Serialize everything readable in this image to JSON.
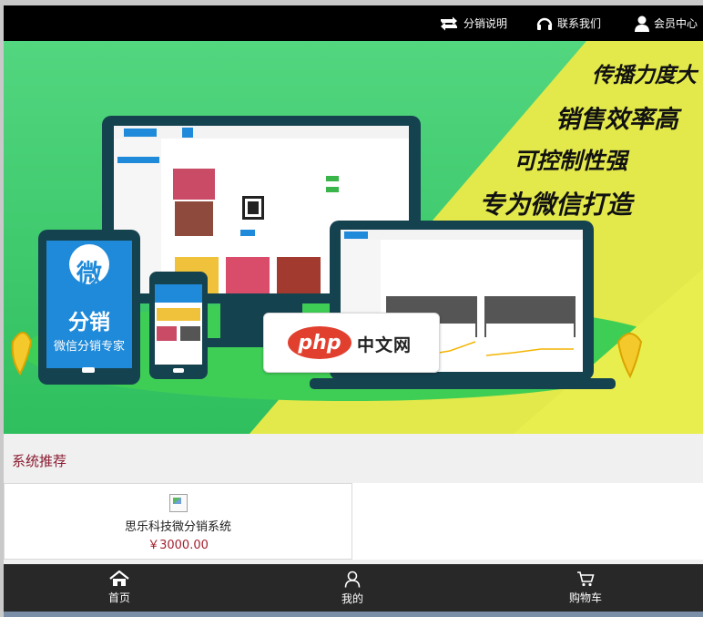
{
  "header": {
    "links": [
      {
        "label": "分销说明",
        "icon": "retweet-icon"
      },
      {
        "label": "联系我们",
        "icon": "headset-icon"
      },
      {
        "label": "会员中心",
        "icon": "user-icon"
      }
    ]
  },
  "banner": {
    "slogans": [
      "传播力度大",
      "销售效率高",
      "可控制性强",
      "专为微信打造"
    ],
    "tablet_logo_char": "微",
    "tablet_logo_word": "分销",
    "tablet_caption": "微信分销专家",
    "watermark": {
      "php": "php",
      "text": "中文网"
    },
    "colors": {
      "green": "#3cc86e",
      "yellow": "#e3e94a",
      "navy": "#15424f",
      "blue": "#1f8ad9"
    }
  },
  "section": {
    "title": "系统推荐"
  },
  "products": [
    {
      "name": "思乐科技微分销系统",
      "price": "￥3000.00"
    }
  ],
  "bottom_nav": {
    "items": [
      {
        "label": "首页",
        "icon": "home-icon"
      },
      {
        "label": "我的",
        "icon": "profile-icon"
      },
      {
        "label": "购物车",
        "icon": "cart-icon"
      }
    ]
  }
}
